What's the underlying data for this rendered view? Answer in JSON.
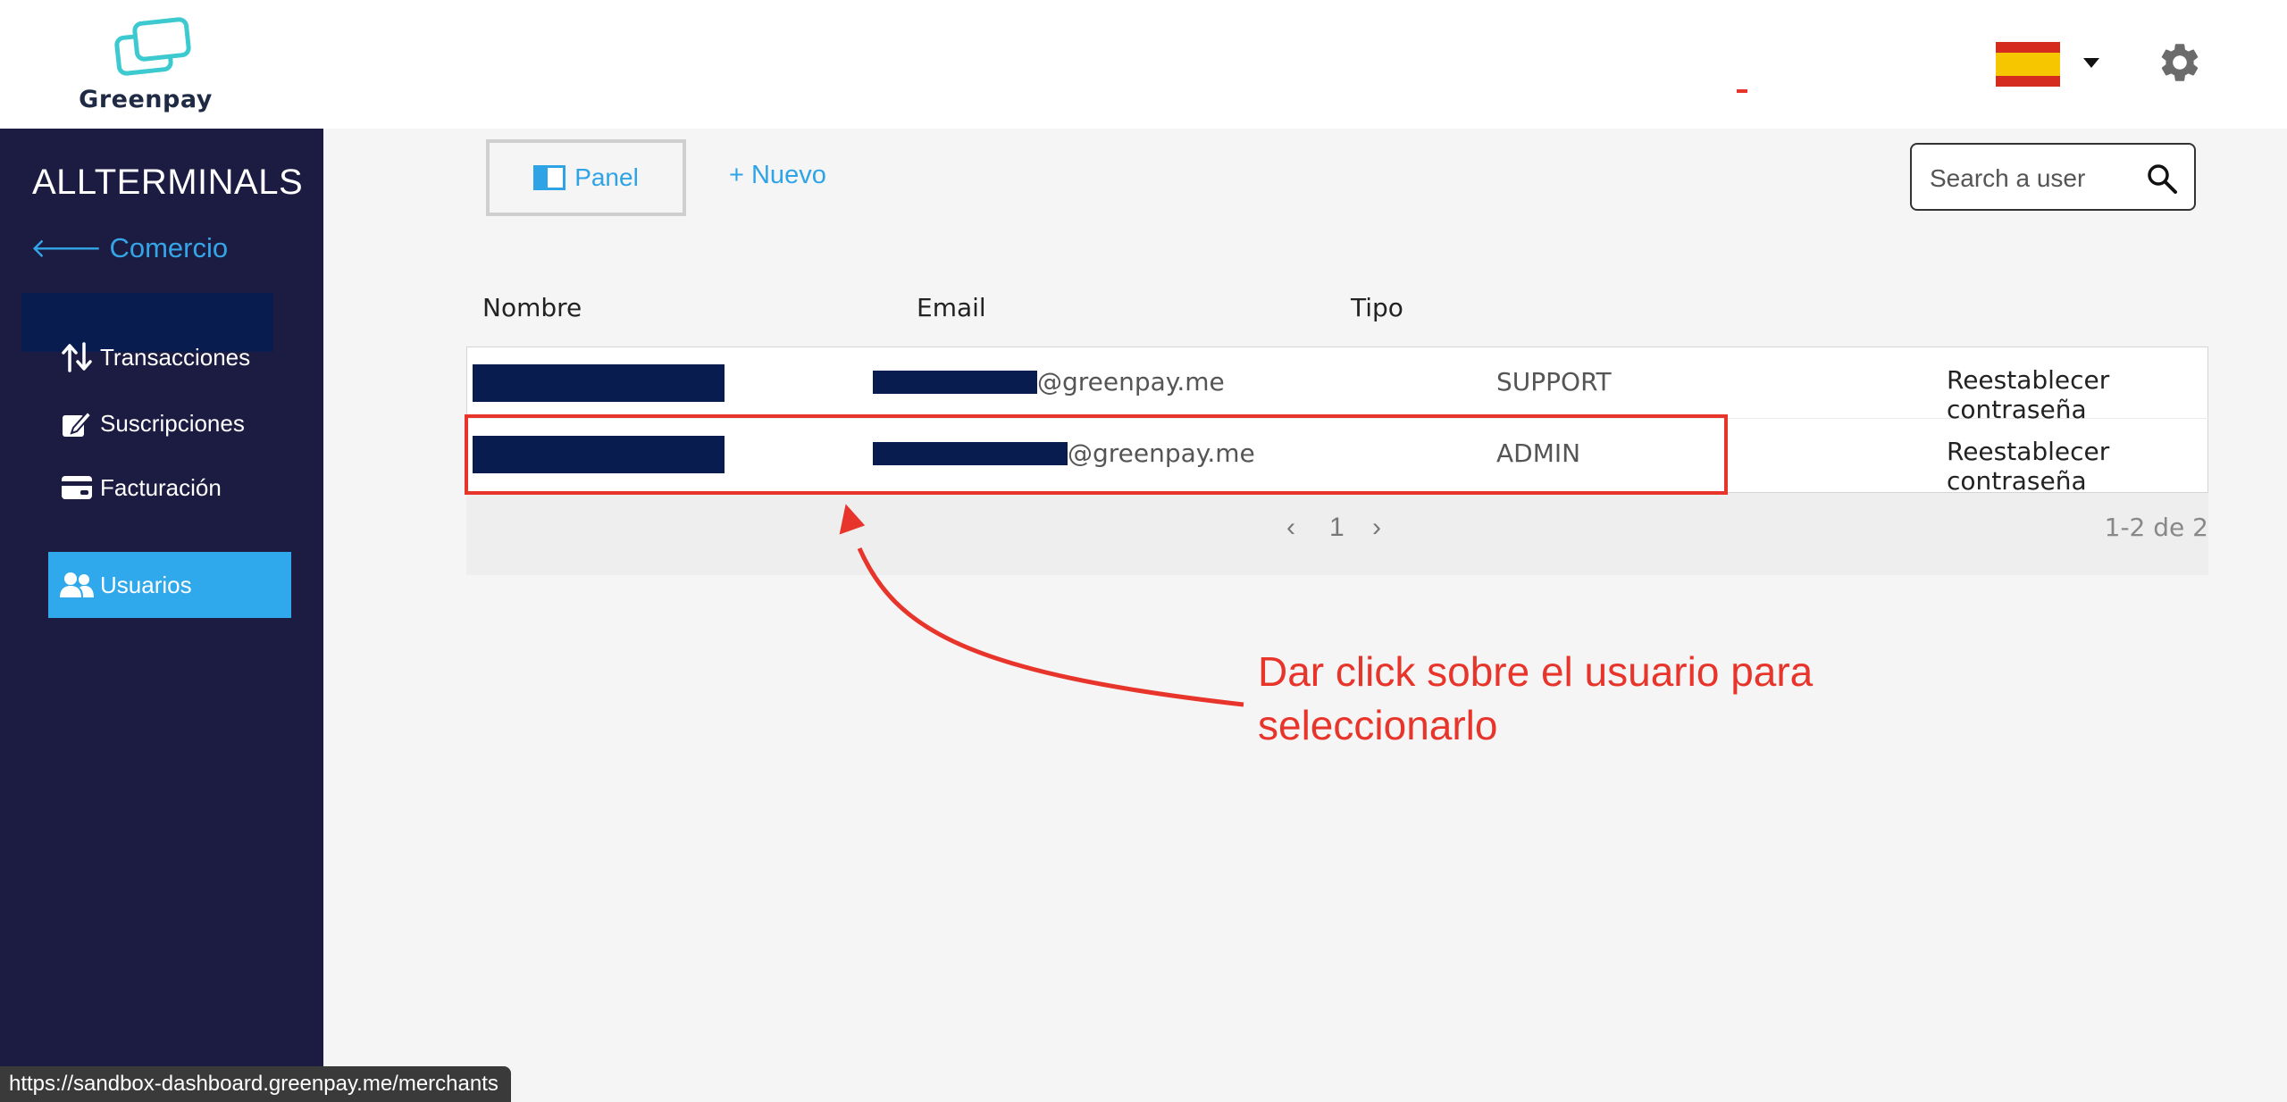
{
  "header": {
    "logo_text": "Greenpay"
  },
  "sidebar": {
    "merchant_name": "ALLTERMINALS",
    "back_label": "Comercio",
    "items": [
      {
        "label": "Transacciones",
        "icon": "arrows-up-down-icon",
        "active": false
      },
      {
        "label": "Suscripciones",
        "icon": "edit-icon",
        "active": false
      },
      {
        "label": "Facturación",
        "icon": "credit-card-icon",
        "active": false
      },
      {
        "label": "Usuarios",
        "icon": "users-icon",
        "active": true
      }
    ]
  },
  "toolbar": {
    "panel_label": "Panel",
    "new_label": "+ Nuevo",
    "search_placeholder": "Search a user"
  },
  "table": {
    "headers": [
      "Nombre",
      "Email",
      "Tipo"
    ],
    "rows": [
      {
        "email_suffix": "@greenpay.me",
        "type": "SUPPORT",
        "action": "Reestablecer contraseña"
      },
      {
        "email_suffix": "@greenpay.me",
        "type": "ADMIN",
        "action": "Reestablecer contraseña"
      }
    ]
  },
  "pagination": {
    "prev": "‹",
    "page": "1",
    "next": "›",
    "count": "1-2 de 2"
  },
  "annotation": {
    "text": "Dar click sobre el usuario para seleccionarlo",
    "color": "#e8352b"
  },
  "status_bar": {
    "url": "https://sandbox-dashboard.greenpay.me/merchants"
  },
  "colors": {
    "sidebar_bg": "#1c1b41",
    "accent": "#2fa8ec",
    "redaction": "#081c4f"
  }
}
